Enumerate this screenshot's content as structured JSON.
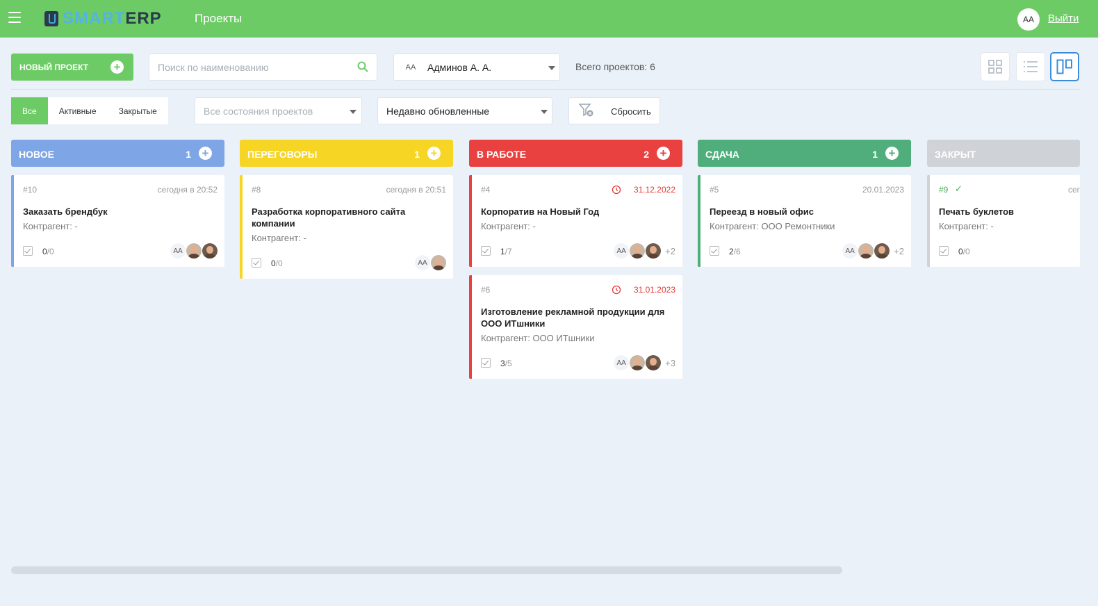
{
  "header": {
    "logo_smart": "SMART",
    "logo_erp": "ERP",
    "nav_title": "Проекты",
    "user_initials": "AA",
    "logout_label": "Выйти"
  },
  "toolbar": {
    "new_project_label": "НОВЫЙ ПРОЕКТ",
    "search_placeholder": "Поиск по наименованию",
    "user_initials": "AA",
    "user_name": "Админов А. А.",
    "total_label": "Всего проектов: 6"
  },
  "filters": {
    "tabs": [
      "Все",
      "Активные",
      "Закрытые"
    ],
    "active_tab": 0,
    "state_select": "Все состояния проектов",
    "sort_select": "Недавно обновленные",
    "reset_label": "Сбросить"
  },
  "columns": [
    {
      "title": "НОВОЕ",
      "count": "1",
      "color": "#7ea6e6",
      "cards": [
        {
          "num": "#10",
          "date": "сегодня в 20:52",
          "title": "Заказать брендбук",
          "contractor": "Контрагент: -",
          "tasks_done": "0",
          "tasks_total": "/0",
          "initials": "AA",
          "photos": 2,
          "more": ""
        }
      ]
    },
    {
      "title": "ПЕРЕГОВОРЫ",
      "count": "1",
      "color": "#f7d524",
      "cards": [
        {
          "num": "#8",
          "date": "сегодня в 20:51",
          "title": "Разработка корпоративного сайта компании",
          "contractor": "Контрагент: -",
          "tasks_done": "0",
          "tasks_total": "/0",
          "initials": "AA",
          "photos": 1,
          "more": ""
        }
      ]
    },
    {
      "title": "В РАБОТЕ",
      "count": "2",
      "color": "#e94040",
      "cards": [
        {
          "num": "#4",
          "date": "31.12.2022",
          "title": "Корпоратив на Новый Год",
          "contractor": "Контрагент: -",
          "tasks_done": "1",
          "tasks_total": "/7",
          "initials": "AA",
          "photos": 2,
          "more": "+2"
        },
        {
          "num": "#6",
          "date": "31.01.2023",
          "title": "Изготовление рекламной продукции для ООО ИТшники",
          "contractor": "Контрагент: ООО ИТшники",
          "tasks_done": "3",
          "tasks_total": "/5",
          "initials": "AA",
          "photos": 2,
          "more": "+3"
        }
      ]
    },
    {
      "title": "СДАЧА",
      "count": "1",
      "color": "#4fae7c",
      "cards": [
        {
          "num": "#5",
          "date": "20.01.2023",
          "title": "Переезд в новый офис",
          "contractor": "Контрагент: ООО Ремонтники",
          "tasks_done": "2",
          "tasks_total": "/6",
          "initials": "AA",
          "photos": 2,
          "more": "+2"
        }
      ]
    },
    {
      "title": "ЗАКРЫТ",
      "count": "",
      "color": "#cfd2d6",
      "cards": [
        {
          "num": "#9",
          "date": "сег",
          "title": "Печать буклетов",
          "contractor": "Контрагент: -",
          "tasks_done": "0",
          "tasks_total": "/0",
          "initials": "",
          "photos": 0,
          "more": ""
        }
      ]
    }
  ]
}
